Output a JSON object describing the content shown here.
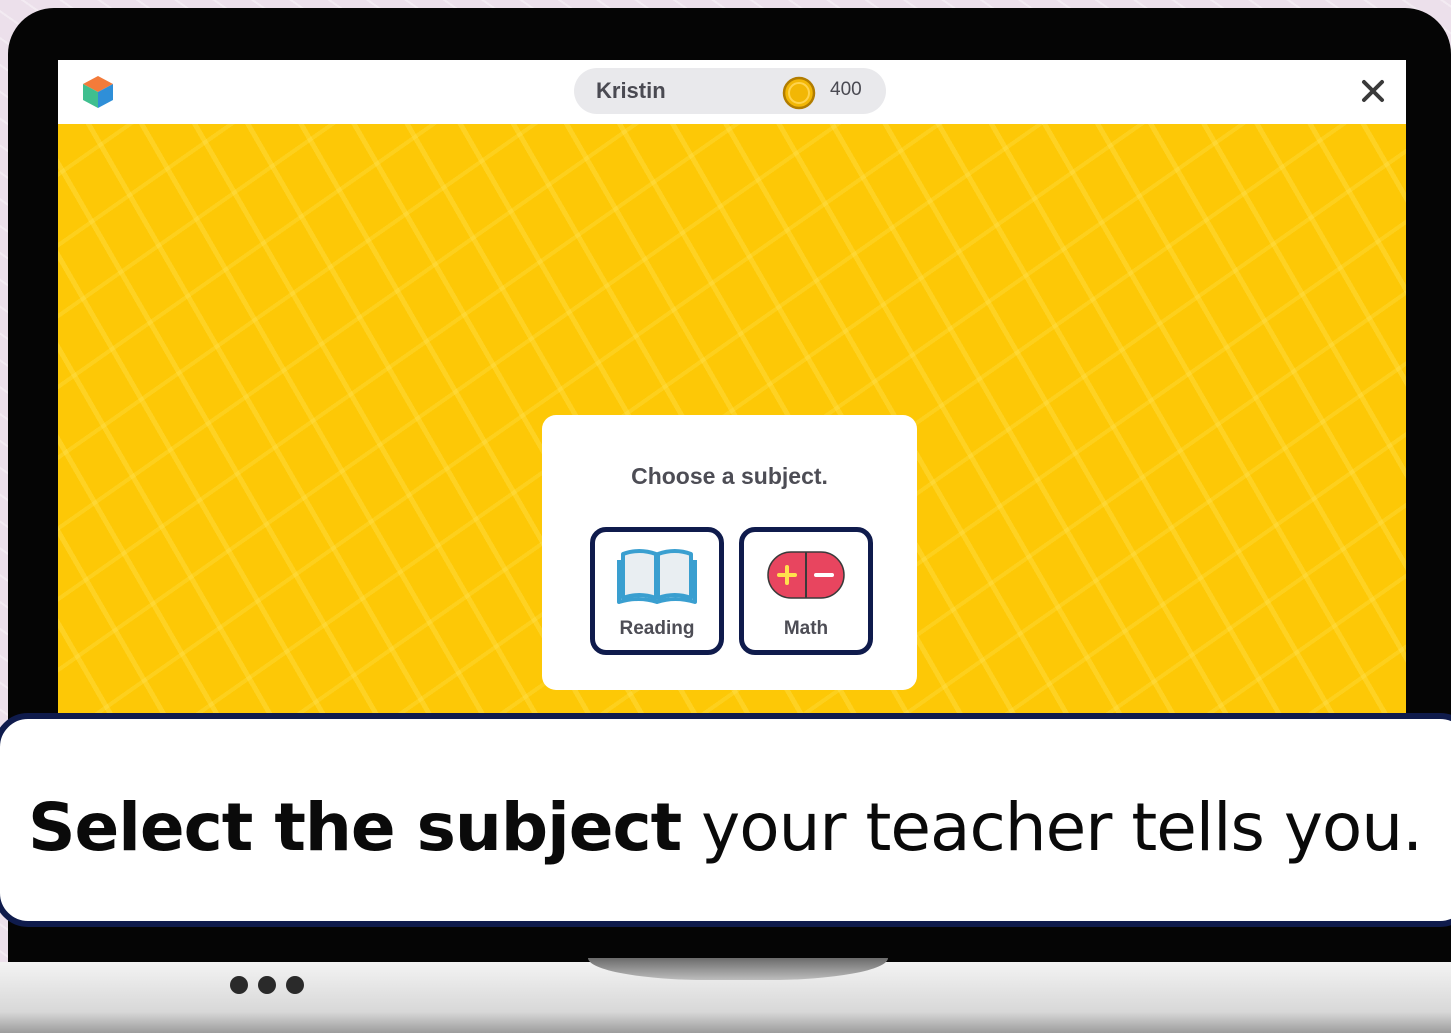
{
  "user": {
    "name": "Kristin",
    "coins": "400"
  },
  "dialog": {
    "title": "Choose a subject.",
    "subjects": [
      {
        "label": "Reading",
        "icon": "open-book-icon"
      },
      {
        "label": "Math",
        "icon": "plus-minus-icon"
      }
    ]
  },
  "caption": {
    "bold": "Select the subject",
    "rest": " your teacher tells you."
  },
  "colors": {
    "background_yellow": "#fdc806",
    "button_border": "#0f1b4c",
    "math_icon": "#e8455f",
    "reading_icon": "#3a9fd0",
    "coin": "#f2b705"
  }
}
